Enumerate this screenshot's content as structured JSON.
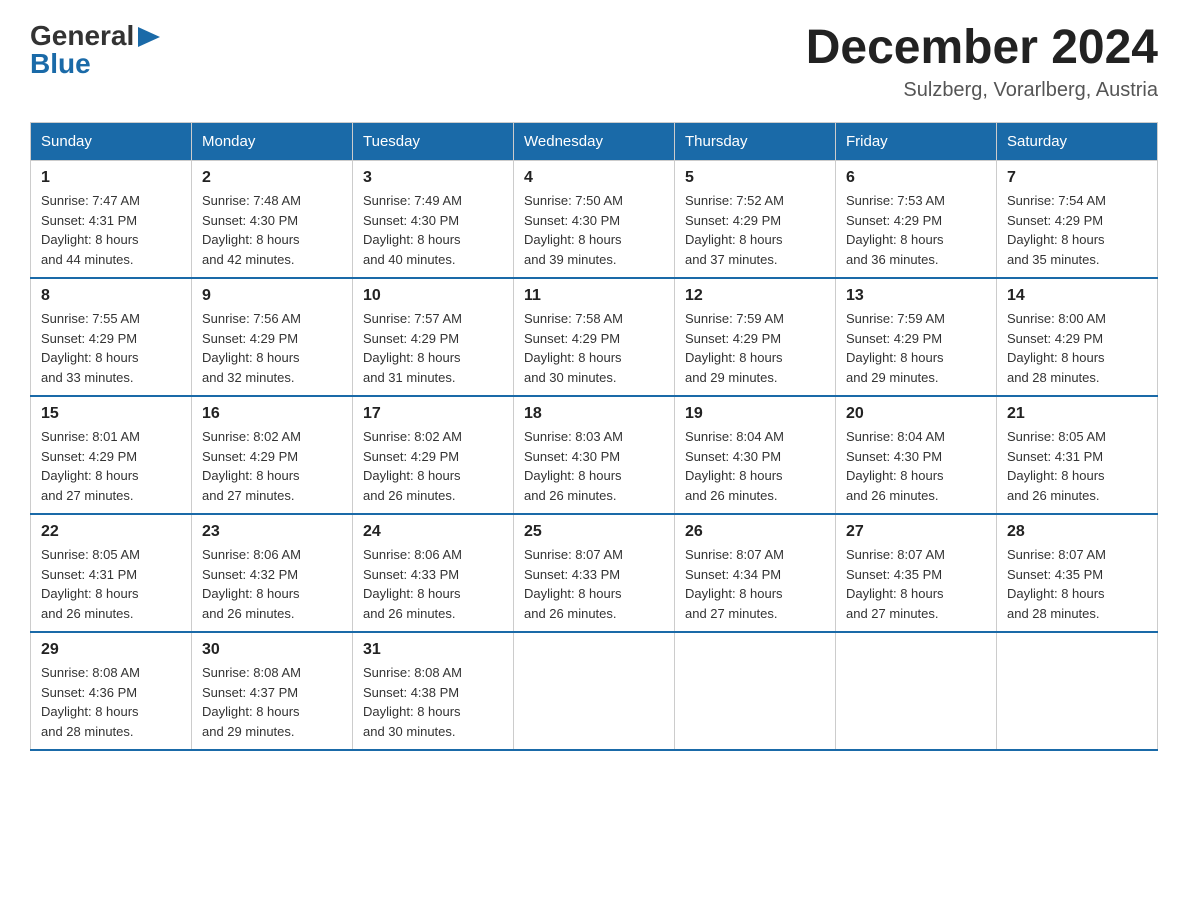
{
  "header": {
    "month_year": "December 2024",
    "location": "Sulzberg, Vorarlberg, Austria",
    "logo_line1": "General",
    "logo_line2": "Blue"
  },
  "columns": [
    "Sunday",
    "Monday",
    "Tuesday",
    "Wednesday",
    "Thursday",
    "Friday",
    "Saturday"
  ],
  "weeks": [
    [
      {
        "day": "1",
        "info": "Sunrise: 7:47 AM\nSunset: 4:31 PM\nDaylight: 8 hours\nand 44 minutes."
      },
      {
        "day": "2",
        "info": "Sunrise: 7:48 AM\nSunset: 4:30 PM\nDaylight: 8 hours\nand 42 minutes."
      },
      {
        "day": "3",
        "info": "Sunrise: 7:49 AM\nSunset: 4:30 PM\nDaylight: 8 hours\nand 40 minutes."
      },
      {
        "day": "4",
        "info": "Sunrise: 7:50 AM\nSunset: 4:30 PM\nDaylight: 8 hours\nand 39 minutes."
      },
      {
        "day": "5",
        "info": "Sunrise: 7:52 AM\nSunset: 4:29 PM\nDaylight: 8 hours\nand 37 minutes."
      },
      {
        "day": "6",
        "info": "Sunrise: 7:53 AM\nSunset: 4:29 PM\nDaylight: 8 hours\nand 36 minutes."
      },
      {
        "day": "7",
        "info": "Sunrise: 7:54 AM\nSunset: 4:29 PM\nDaylight: 8 hours\nand 35 minutes."
      }
    ],
    [
      {
        "day": "8",
        "info": "Sunrise: 7:55 AM\nSunset: 4:29 PM\nDaylight: 8 hours\nand 33 minutes."
      },
      {
        "day": "9",
        "info": "Sunrise: 7:56 AM\nSunset: 4:29 PM\nDaylight: 8 hours\nand 32 minutes."
      },
      {
        "day": "10",
        "info": "Sunrise: 7:57 AM\nSunset: 4:29 PM\nDaylight: 8 hours\nand 31 minutes."
      },
      {
        "day": "11",
        "info": "Sunrise: 7:58 AM\nSunset: 4:29 PM\nDaylight: 8 hours\nand 30 minutes."
      },
      {
        "day": "12",
        "info": "Sunrise: 7:59 AM\nSunset: 4:29 PM\nDaylight: 8 hours\nand 29 minutes."
      },
      {
        "day": "13",
        "info": "Sunrise: 7:59 AM\nSunset: 4:29 PM\nDaylight: 8 hours\nand 29 minutes."
      },
      {
        "day": "14",
        "info": "Sunrise: 8:00 AM\nSunset: 4:29 PM\nDaylight: 8 hours\nand 28 minutes."
      }
    ],
    [
      {
        "day": "15",
        "info": "Sunrise: 8:01 AM\nSunset: 4:29 PM\nDaylight: 8 hours\nand 27 minutes."
      },
      {
        "day": "16",
        "info": "Sunrise: 8:02 AM\nSunset: 4:29 PM\nDaylight: 8 hours\nand 27 minutes."
      },
      {
        "day": "17",
        "info": "Sunrise: 8:02 AM\nSunset: 4:29 PM\nDaylight: 8 hours\nand 26 minutes."
      },
      {
        "day": "18",
        "info": "Sunrise: 8:03 AM\nSunset: 4:30 PM\nDaylight: 8 hours\nand 26 minutes."
      },
      {
        "day": "19",
        "info": "Sunrise: 8:04 AM\nSunset: 4:30 PM\nDaylight: 8 hours\nand 26 minutes."
      },
      {
        "day": "20",
        "info": "Sunrise: 8:04 AM\nSunset: 4:30 PM\nDaylight: 8 hours\nand 26 minutes."
      },
      {
        "day": "21",
        "info": "Sunrise: 8:05 AM\nSunset: 4:31 PM\nDaylight: 8 hours\nand 26 minutes."
      }
    ],
    [
      {
        "day": "22",
        "info": "Sunrise: 8:05 AM\nSunset: 4:31 PM\nDaylight: 8 hours\nand 26 minutes."
      },
      {
        "day": "23",
        "info": "Sunrise: 8:06 AM\nSunset: 4:32 PM\nDaylight: 8 hours\nand 26 minutes."
      },
      {
        "day": "24",
        "info": "Sunrise: 8:06 AM\nSunset: 4:33 PM\nDaylight: 8 hours\nand 26 minutes."
      },
      {
        "day": "25",
        "info": "Sunrise: 8:07 AM\nSunset: 4:33 PM\nDaylight: 8 hours\nand 26 minutes."
      },
      {
        "day": "26",
        "info": "Sunrise: 8:07 AM\nSunset: 4:34 PM\nDaylight: 8 hours\nand 27 minutes."
      },
      {
        "day": "27",
        "info": "Sunrise: 8:07 AM\nSunset: 4:35 PM\nDaylight: 8 hours\nand 27 minutes."
      },
      {
        "day": "28",
        "info": "Sunrise: 8:07 AM\nSunset: 4:35 PM\nDaylight: 8 hours\nand 28 minutes."
      }
    ],
    [
      {
        "day": "29",
        "info": "Sunrise: 8:08 AM\nSunset: 4:36 PM\nDaylight: 8 hours\nand 28 minutes."
      },
      {
        "day": "30",
        "info": "Sunrise: 8:08 AM\nSunset: 4:37 PM\nDaylight: 8 hours\nand 29 minutes."
      },
      {
        "day": "31",
        "info": "Sunrise: 8:08 AM\nSunset: 4:38 PM\nDaylight: 8 hours\nand 30 minutes."
      },
      {
        "day": "",
        "info": ""
      },
      {
        "day": "",
        "info": ""
      },
      {
        "day": "",
        "info": ""
      },
      {
        "day": "",
        "info": ""
      }
    ]
  ]
}
